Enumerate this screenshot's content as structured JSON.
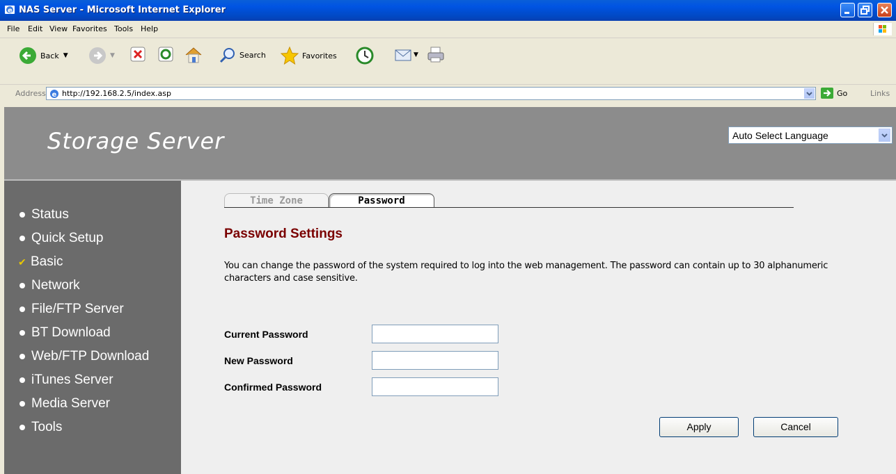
{
  "window": {
    "title": "NAS Server - Microsoft Internet Explorer"
  },
  "menu": [
    "File",
    "Edit",
    "View",
    "Favorites",
    "Tools",
    "Help"
  ],
  "toolbar": {
    "back_label": "Back",
    "search_label": "Search",
    "favorites_label": "Favorites"
  },
  "address": {
    "label": "Address",
    "url": "http://192.168.2.5/index.asp",
    "go_label": "Go",
    "links_label": "Links"
  },
  "header": {
    "brand": "Storage Server",
    "language_select": "Auto Select Language"
  },
  "sidebar": {
    "items": [
      {
        "label": "Status"
      },
      {
        "label": "Quick Setup"
      },
      {
        "label": "Basic"
      },
      {
        "label": "Network"
      },
      {
        "label": "File/FTP Server"
      },
      {
        "label": "BT Download"
      },
      {
        "label": "Web/FTP Download"
      },
      {
        "label": "iTunes Server"
      },
      {
        "label": "Media Server"
      },
      {
        "label": "Tools"
      }
    ]
  },
  "tabs": {
    "time_zone": "Time Zone",
    "password": "Password"
  },
  "main": {
    "heading": "Password Settings",
    "description": "You can change the password of the system required to log into the web management. The password can contain up to 30 alphanumeric characters and case sensitive.",
    "fields": {
      "current": "Current Password",
      "new": "New Password",
      "confirmed": "Confirmed Password"
    },
    "apply_label": "Apply",
    "cancel_label": "Cancel"
  },
  "colors": {
    "heading": "#7A0000",
    "sidebar": "#6B6B6B",
    "header": "#8C8C8C",
    "title_bar": "#0054E3"
  },
  "icons": [
    "ie-icon",
    "back-icon",
    "forward-icon",
    "stop-icon",
    "refresh-icon",
    "home-icon",
    "search-icon",
    "favorites-icon",
    "history-icon",
    "mail-icon",
    "print-icon",
    "go-icon",
    "windows-flag-icon",
    "checkmark-icon"
  ]
}
